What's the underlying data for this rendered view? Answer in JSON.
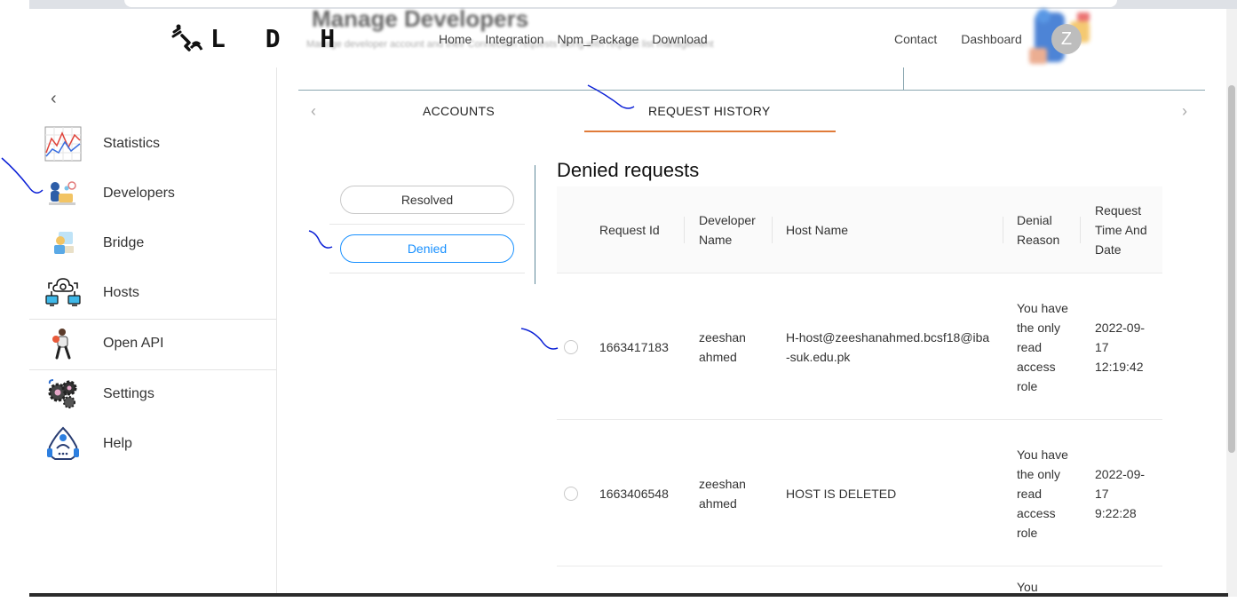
{
  "header": {
    "logo_text": "L D H",
    "blurred_title": "Manage Developers",
    "blurred_subtitle": "Manage developer account and their Connection requests along with request list management",
    "nav": [
      "Home",
      "Integration",
      "Npm_Package",
      "Download"
    ],
    "nav_right": [
      "Contact",
      "Dashboard"
    ],
    "avatar_letter": "Z"
  },
  "sidebar": {
    "items": [
      {
        "label": "Statistics",
        "icon": "statistics-chart-icon"
      },
      {
        "label": "Developers",
        "icon": "developers-icon"
      },
      {
        "label": "Bridge",
        "icon": "bridge-icon"
      },
      {
        "label": "Hosts",
        "icon": "hosts-network-icon"
      },
      {
        "label": "Open API",
        "icon": "open-api-icon"
      },
      {
        "label": "Settings",
        "icon": "settings-gears-icon"
      },
      {
        "label": "Help",
        "icon": "help-headset-icon"
      }
    ]
  },
  "tabs": {
    "accounts": "ACCOUNTS",
    "request_history": "REQUEST HISTORY",
    "active": "REQUEST HISTORY"
  },
  "filters": {
    "resolved": "Resolved",
    "denied": "Denied",
    "active": "Denied"
  },
  "section_title": "Denied requests",
  "table": {
    "headers": {
      "request_id": "Request Id",
      "developer_name": "Developer Name",
      "host_name": "Host Name",
      "denial_reason": "Denial Reason",
      "request_time": "Request Time And Date"
    },
    "rows": [
      {
        "request_id": "1663417183",
        "developer_name": "zeeshan ahmed",
        "host_name": "H-host@zeeshanahmed.bcsf18@iba-suk.edu.pk",
        "denial_reason": "You have the only read access role",
        "request_time": "2022-09-17 12:19:42"
      },
      {
        "request_id": "1663406548",
        "developer_name": "zeeshan ahmed",
        "host_name": "HOST IS DELETED",
        "denial_reason": "You have the only read access role",
        "request_time": "2022-09-17 9:22:28"
      },
      {
        "denial_reason_partial": "You"
      }
    ]
  },
  "colors": {
    "accent_blue": "#1890ff",
    "tab_underline": "#e07b39",
    "annotation_ink": "#0a1fd6"
  }
}
